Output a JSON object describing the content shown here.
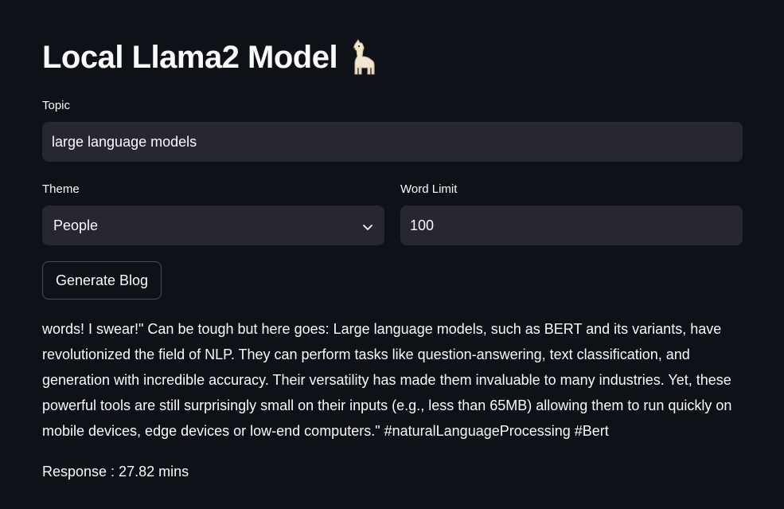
{
  "app": {
    "title": "Local Llama2 Model",
    "title_icon": "llama-icon"
  },
  "form": {
    "topic": {
      "label": "Topic",
      "value": "large language models"
    },
    "theme": {
      "label": "Theme",
      "selected": "People",
      "icon": "chevron-down-icon"
    },
    "word_limit": {
      "label": "Word Limit",
      "value": "100"
    },
    "generate_button_label": "Generate Blog"
  },
  "output": {
    "text": "words! I swear!\" Can be tough but here goes: Large language models, such as BERT and its variants, have revolutionized the field of NLP. They can perform tasks like question-answering, text classification, and generation with incredible accuracy. Their versatility has made them invaluable to many industries. Yet, these powerful tools are still surprisingly small on their inputs (e.g., less than 65MB) allowing them to run quickly on mobile devices, edge devices or low-end computers.\" #naturalLanguageProcessing #Bert",
    "response_time": "Response : 27.82 mins"
  },
  "colors": {
    "background": "#0e1117",
    "input_background": "#262730",
    "text": "#fafafa"
  }
}
